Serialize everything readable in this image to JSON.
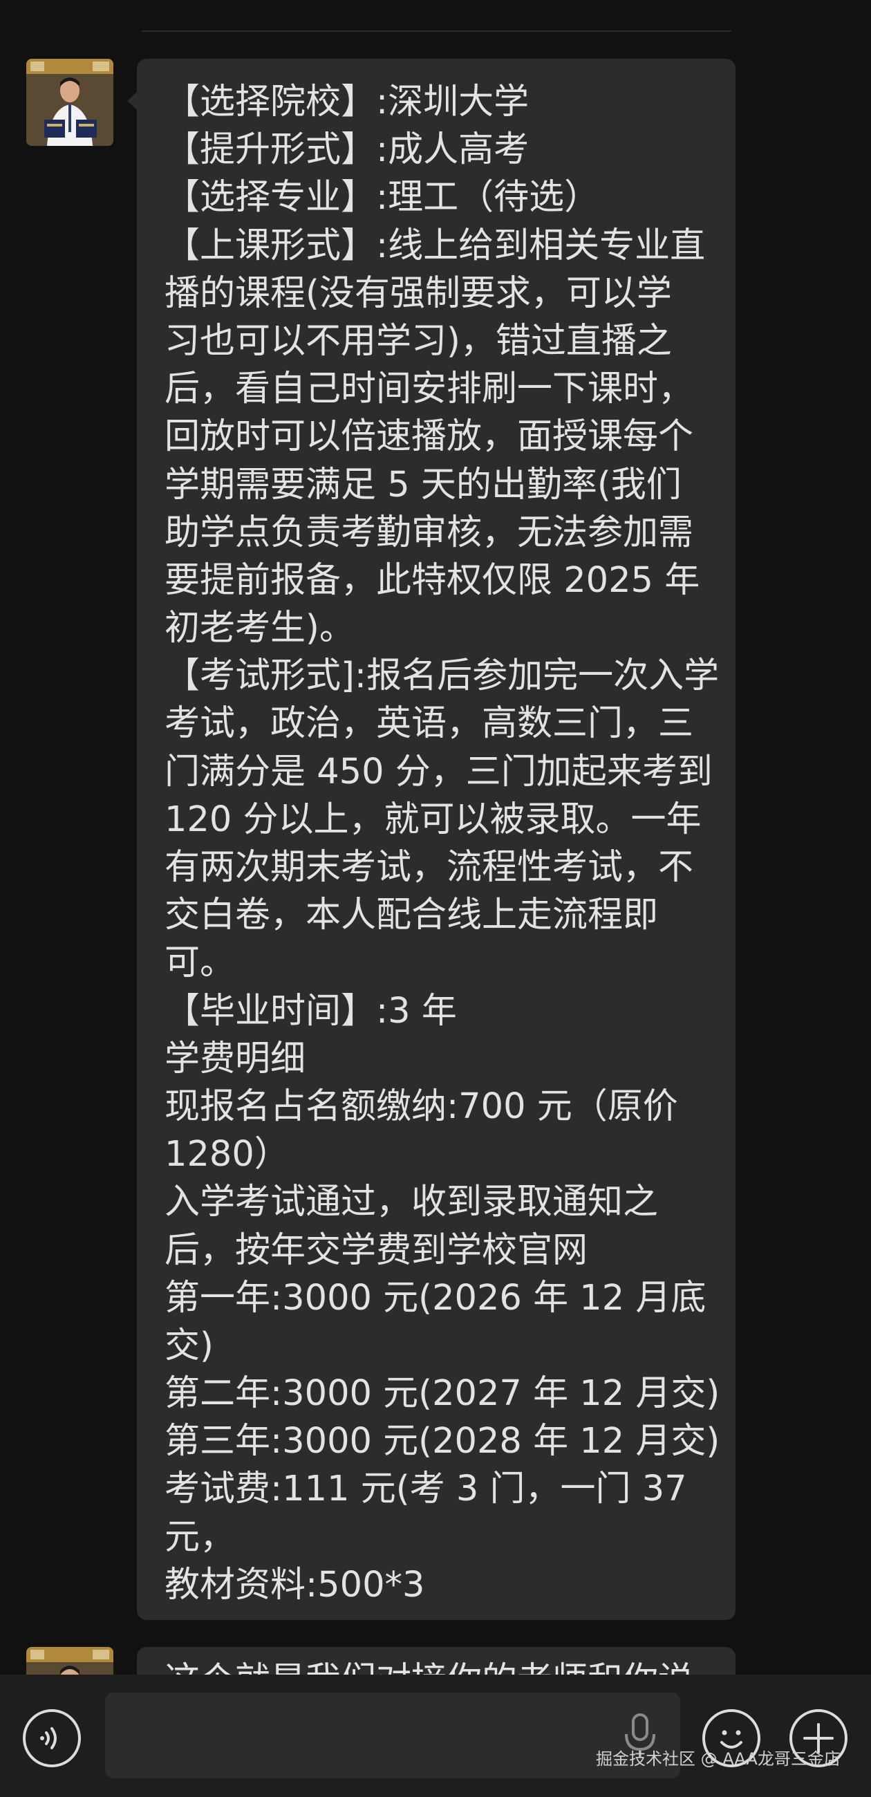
{
  "chat": {
    "messages": [
      {
        "sender": "contact",
        "avatar_icon": "contact-avatar-photo",
        "lines": [
          "【选择院校】:深圳大学",
          "【提升形式】:成人高考",
          "【选择专业】:理工（待选）",
          "【上课形式】:线上给到相关专业直",
          "播的课程(没有强制要求，可以学",
          "习也可以不用学习)，错过直播之",
          "后，看自己时间安排刷一下课时，",
          "回放时可以倍速播放，面授课每个",
          "学期需要满足 5 天的出勤率(我们",
          "助学点负责考勤审核，无法参加需",
          "要提前报备，此特权仅限 2025 年",
          "初老考生)。",
          "【考试形式]:报名后参加完一次入学",
          "考试，政治，英语，高数三门，三",
          "门满分是 450 分，三门加起来考到",
          "120 分以上，就可以被录取。一年",
          "有两次期末考试，流程性考试，不",
          "交白卷，本人配合线上走流程即",
          "可。",
          "【毕业时间】:3 年",
          "学费明细",
          "现报名占名额缴纳:700 元（原价",
          "1280）",
          "入学考试通过，收到录取通知之",
          "后，按年交学费到学校官网",
          "第一年:3000 元(2026 年 12 月底",
          "交)",
          "第二年:3000 元(2027 年 12 月交)",
          "第三年:3000 元(2028 年 12 月交)",
          "考试费:111 元(考 3 门，一门 37",
          "元，",
          "教材资料:500*3"
        ]
      },
      {
        "sender": "contact",
        "avatar_icon": "contact-avatar-photo",
        "partial_text": "这个就是我们对接你的老师和你说"
      }
    ]
  },
  "input_bar": {
    "voice_icon": "voice-toggle-icon",
    "text_value": "",
    "mic_icon": "microphone-icon",
    "emoji_icon": "emoji-icon",
    "more_icon": "plus-icon"
  },
  "watermark": "掘金技术社区 @ AAA龙哥三金店",
  "colors": {
    "background": "#111111",
    "bubble": "#2c2c2c",
    "text": "#e3e3e3",
    "input_bar": "#1e1e1e"
  }
}
